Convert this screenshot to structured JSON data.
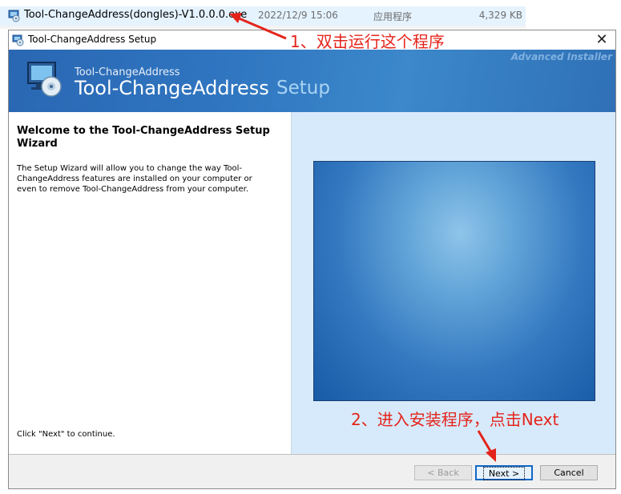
{
  "explorer": {
    "file_name": "Tool-ChangeAddress(dongles)-V1.0.0.0.exe",
    "modified": "2022/12/9 15:06",
    "type": "应用程序",
    "size": "4,329 KB",
    "icon": "installer-icon"
  },
  "window": {
    "title": "Tool-ChangeAddress Setup",
    "close_glyph": "✕"
  },
  "banner": {
    "product_small": "Tool-ChangeAddress",
    "product_big": "Tool-ChangeAddress",
    "setup": "Setup",
    "brand": "Advanced Installer"
  },
  "content": {
    "welcome_title": "Welcome to the Tool-ChangeAddress Setup Wizard",
    "description": "The Setup Wizard will allow you to change the way Tool-ChangeAddress features are installed on your computer or even to remove Tool-ChangeAddress from your computer.",
    "continue_hint": "Click \"Next\" to continue."
  },
  "buttons": {
    "back": "< Back",
    "next": "Next >",
    "cancel": "Cancel"
  },
  "annotations": {
    "step1": "1、双击运行这个程序",
    "step2": "2、进入安装程序，点击Next",
    "color": "#e4241b"
  },
  "colors": {
    "banner": "#2f75c0",
    "right_pane": "#d7eafb",
    "selection": "#e5f3ff"
  }
}
